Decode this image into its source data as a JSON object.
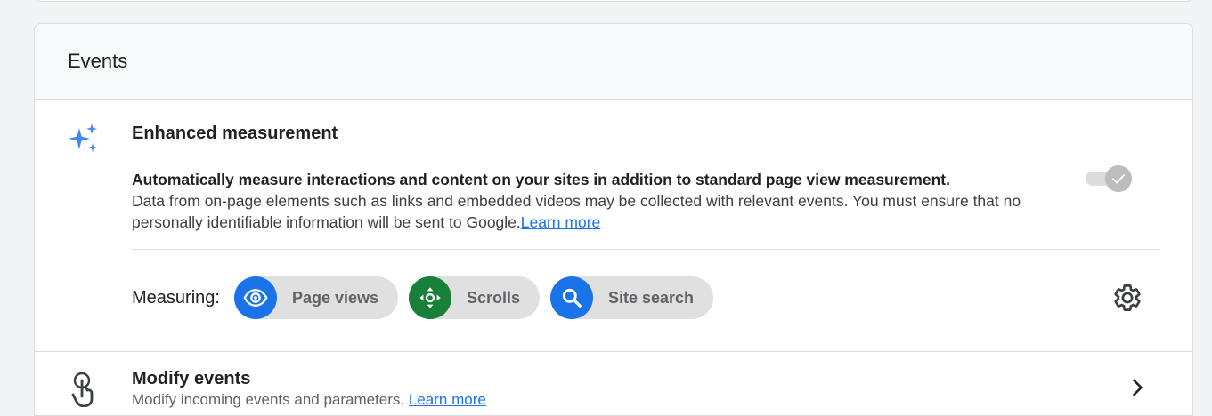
{
  "events": {
    "title": "Events",
    "enhanced_measurement": {
      "title": "Enhanced measurement",
      "lead": "Automatically measure interactions and content on your sites in addition to standard page view measurement.",
      "description": "Data from on-page elements such as links and embedded videos may be collected with relevant events. You must ensure that no personally identifiable information will be sent to Google.",
      "learn_more": "Learn more",
      "toggle_state": "on-disabled",
      "measuring_label": "Measuring:",
      "chips": [
        {
          "label": "Page views",
          "icon": "eye-icon",
          "color": "#1a73e8"
        },
        {
          "label": "Scrolls",
          "icon": "scroll-arrows-icon",
          "color": "#188038"
        },
        {
          "label": "Site search",
          "icon": "search-icon",
          "color": "#1a73e8"
        }
      ]
    },
    "modify_events": {
      "title": "Modify events",
      "subtitle": "Modify incoming events and parameters.",
      "learn_more": "Learn more"
    }
  },
  "colors": {
    "accent": "#1a73e8",
    "green": "#188038",
    "sparkle": "#4285f4"
  }
}
